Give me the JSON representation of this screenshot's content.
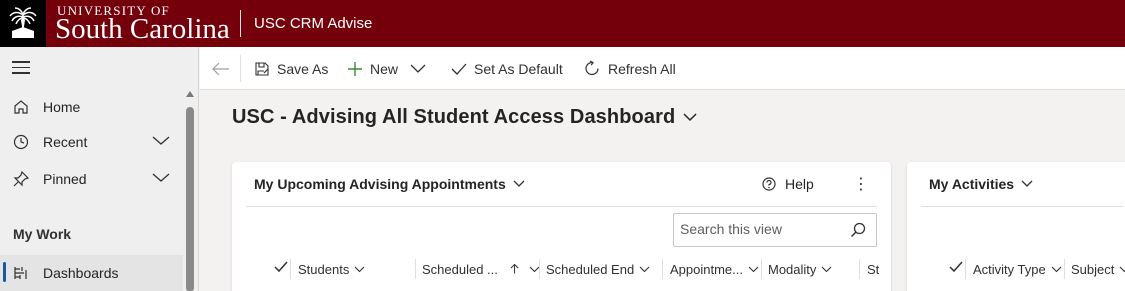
{
  "topbar": {
    "university_small": "UNIVERSITY OF",
    "university_big": "South Carolina",
    "app_title": "USC CRM Advise",
    "brand_color": "#73000a"
  },
  "sidebar": {
    "items": [
      {
        "label": "Home",
        "icon": "home-icon"
      },
      {
        "label": "Recent",
        "icon": "clock-icon"
      },
      {
        "label": "Pinned",
        "icon": "pin-icon"
      }
    ],
    "section_title": "My Work",
    "work_items": [
      {
        "label": "Dashboards",
        "icon": "dashboard-icon",
        "active": true
      }
    ]
  },
  "commandbar": {
    "save_as": "Save As",
    "new": "New",
    "set_as_default": "Set As Default",
    "refresh_all": "Refresh All"
  },
  "dashboard": {
    "title": "USC - Advising All Student Access Dashboard"
  },
  "appointments_card": {
    "title": "My Upcoming Advising Appointments",
    "help": "Help",
    "search_placeholder": "Search this view",
    "columns": [
      "Students",
      "Scheduled ...",
      "Scheduled End",
      "Appointme...",
      "Modality",
      "St"
    ]
  },
  "activities_card": {
    "title": "My Activities",
    "columns": [
      "Activity Type",
      "Subject"
    ]
  }
}
